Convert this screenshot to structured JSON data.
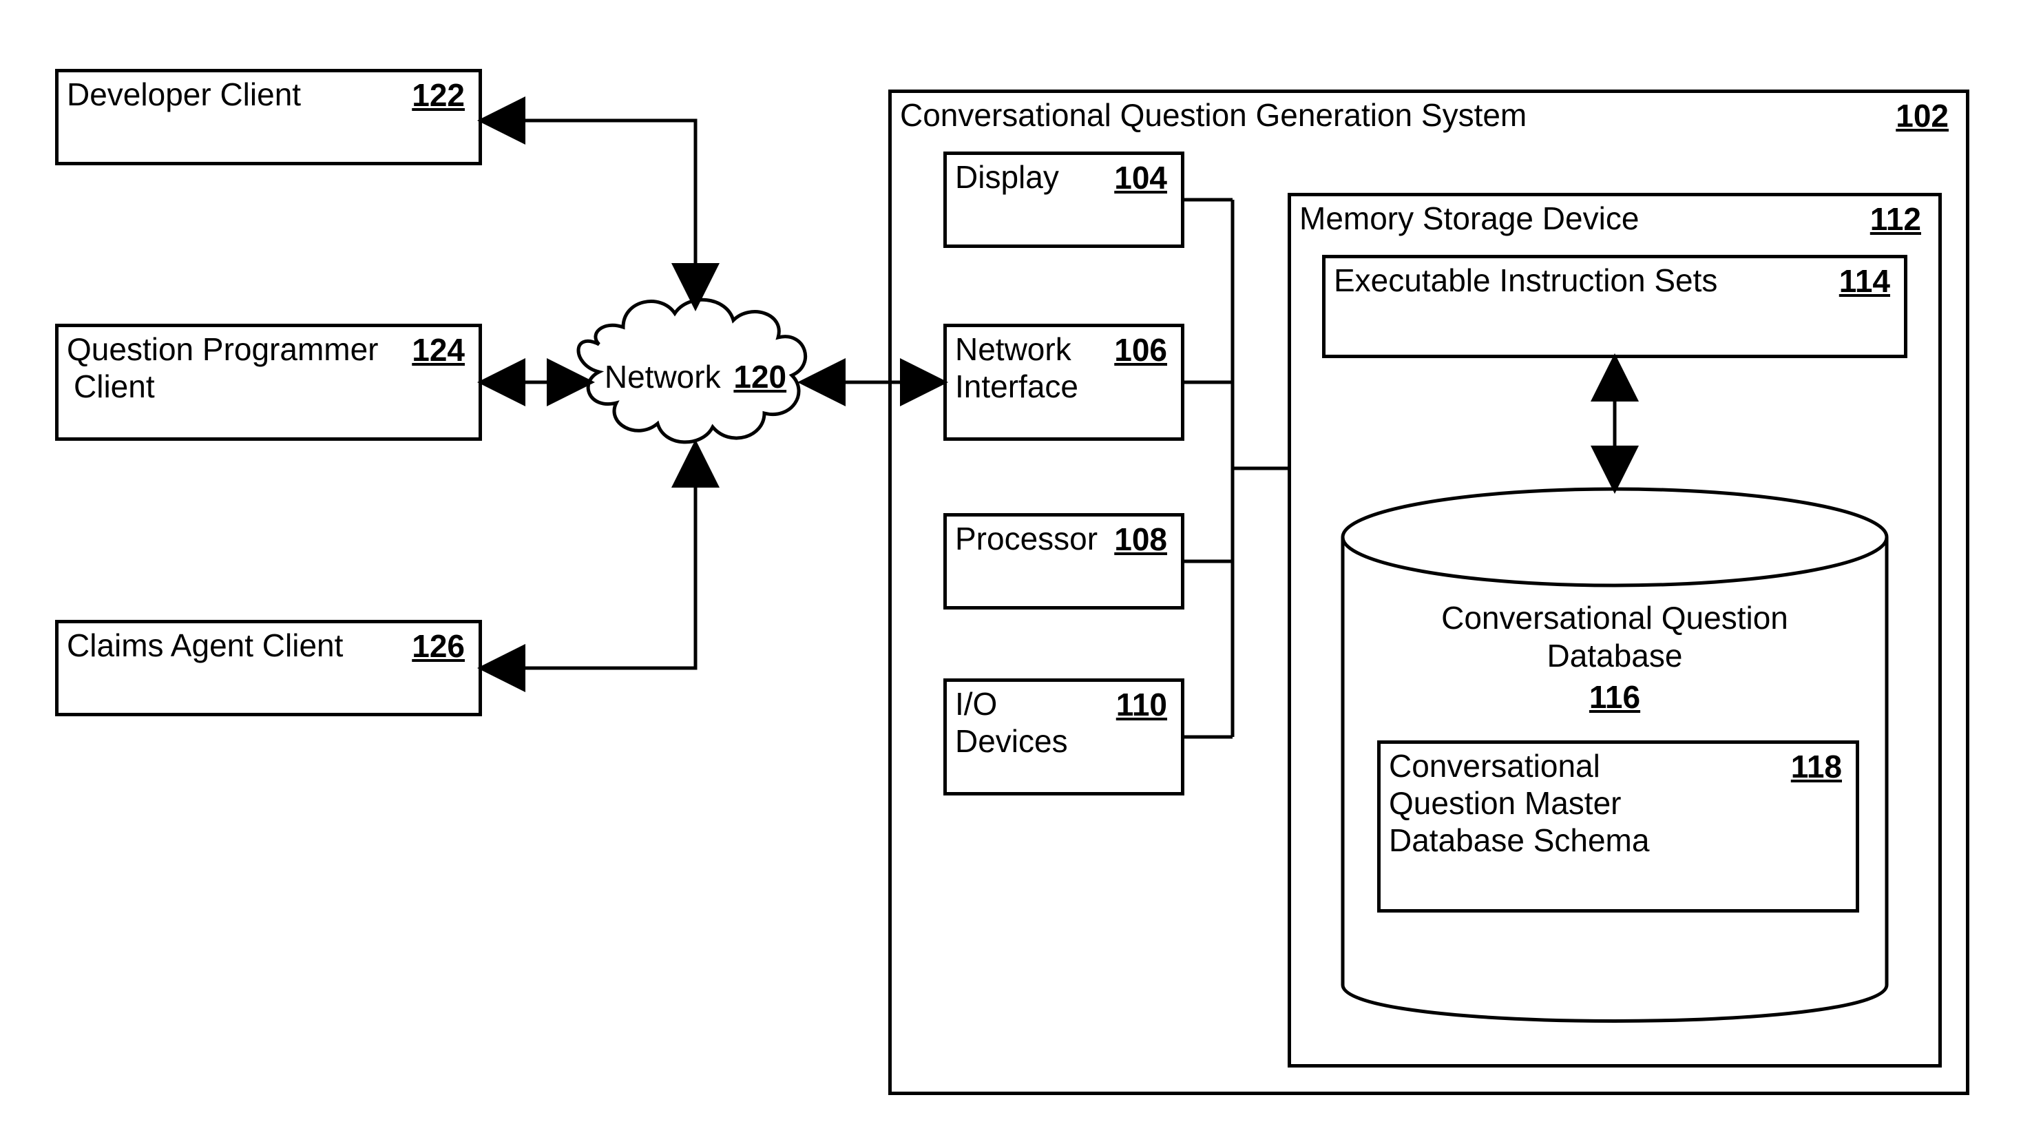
{
  "clients": {
    "developer": {
      "label": "Developer Client",
      "ref": "122"
    },
    "programmer": {
      "label": "Question Programmer",
      "label2": "Client",
      "ref": "124"
    },
    "claims": {
      "label": "Claims Agent Client",
      "ref": "126"
    }
  },
  "network": {
    "label": "Network",
    "ref": "120"
  },
  "system": {
    "title": "Conversational Question Generation System",
    "ref": "102",
    "display": {
      "label": "Display",
      "ref": "104"
    },
    "netif": {
      "label": "Network",
      "label2": "Interface",
      "ref": "106"
    },
    "processor": {
      "label": "Processor",
      "ref": "108"
    },
    "io": {
      "label": "I/O",
      "label2": "Devices",
      "ref": "110"
    },
    "memory": {
      "title": "Memory Storage Device",
      "ref": "112",
      "exec": {
        "label": "Executable Instruction Sets",
        "ref": "114"
      },
      "db": {
        "title1": "Conversational Question",
        "title2": "Database",
        "ref": "116",
        "schema": {
          "label1": "Conversational",
          "label2": "Question Master",
          "label3": "Database Schema",
          "ref": "118"
        }
      }
    }
  }
}
